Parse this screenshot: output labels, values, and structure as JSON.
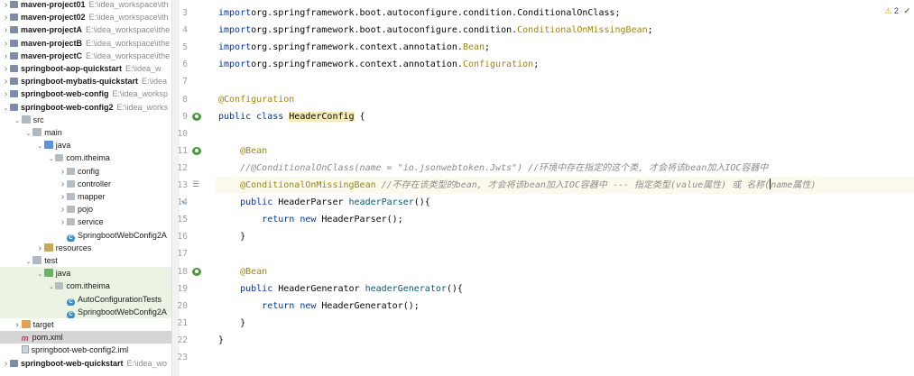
{
  "tree": [
    {
      "label": "maven-project01",
      "path": "E:\\idea_workspace\\ith",
      "icon": "module-icon",
      "arrow": "right",
      "depth": 0,
      "bold": true
    },
    {
      "label": "maven-project02",
      "path": "E:\\idea_workspace\\ith",
      "icon": "module-icon",
      "arrow": "right",
      "depth": 0,
      "bold": true
    },
    {
      "label": "maven-projectA",
      "path": "E:\\idea_workspace\\ithe",
      "icon": "module-icon",
      "arrow": "right",
      "depth": 0,
      "bold": true
    },
    {
      "label": "maven-projectB",
      "path": "E:\\idea_workspace\\ithe",
      "icon": "module-icon",
      "arrow": "right",
      "depth": 0,
      "bold": true
    },
    {
      "label": "maven-projectC",
      "path": "E:\\idea_workspace\\ithe",
      "icon": "module-icon",
      "arrow": "right",
      "depth": 0,
      "bold": true
    },
    {
      "label": "springboot-aop-quickstart",
      "path": "E:\\idea_w",
      "icon": "module-icon",
      "arrow": "right",
      "depth": 0,
      "bold": true
    },
    {
      "label": "springboot-mybatis-quickstart",
      "path": "E:\\idea",
      "icon": "module-icon",
      "arrow": "right",
      "depth": 0,
      "bold": true
    },
    {
      "label": "springboot-web-config",
      "path": "E:\\idea_worksp",
      "icon": "module-icon",
      "arrow": "right",
      "depth": 0,
      "bold": true
    },
    {
      "label": "springboot-web-config2",
      "path": "E:\\idea_works",
      "icon": "module-icon",
      "arrow": "down",
      "depth": 0,
      "bold": true
    },
    {
      "label": "src",
      "path": "",
      "icon": "folder-icon",
      "arrow": "down",
      "depth": 1,
      "bold": false
    },
    {
      "label": "main",
      "path": "",
      "icon": "folder-icon",
      "arrow": "down",
      "depth": 2,
      "bold": false
    },
    {
      "label": "java",
      "path": "",
      "icon": "source-folder-icon",
      "arrow": "down",
      "depth": 3,
      "bold": false
    },
    {
      "label": "com.itheima",
      "path": "",
      "icon": "package-icon",
      "arrow": "down",
      "depth": 4,
      "bold": false
    },
    {
      "label": "config",
      "path": "",
      "icon": "package-icon",
      "arrow": "right",
      "depth": 5,
      "bold": false
    },
    {
      "label": "controller",
      "path": "",
      "icon": "package-icon",
      "arrow": "right",
      "depth": 5,
      "bold": false
    },
    {
      "label": "mapper",
      "path": "",
      "icon": "package-icon",
      "arrow": "right",
      "depth": 5,
      "bold": false
    },
    {
      "label": "pojo",
      "path": "",
      "icon": "package-icon",
      "arrow": "right",
      "depth": 5,
      "bold": false
    },
    {
      "label": "service",
      "path": "",
      "icon": "package-icon",
      "arrow": "right",
      "depth": 5,
      "bold": false
    },
    {
      "label": "SpringbootWebConfig2A",
      "path": "",
      "icon": "spring-class-icon",
      "arrow": "none",
      "depth": 5,
      "bold": false
    },
    {
      "label": "resources",
      "path": "",
      "icon": "resources-folder-icon",
      "arrow": "right",
      "depth": 3,
      "bold": false
    },
    {
      "label": "test",
      "path": "",
      "icon": "folder-icon",
      "arrow": "down",
      "depth": 2,
      "bold": false
    },
    {
      "label": "java",
      "path": "",
      "icon": "test-source-folder-icon",
      "arrow": "down",
      "depth": 3,
      "bold": false,
      "highlight": "green"
    },
    {
      "label": "com.itheima",
      "path": "",
      "icon": "package-icon",
      "arrow": "down",
      "depth": 4,
      "bold": false,
      "highlight": "green"
    },
    {
      "label": "AutoConfigurationTests",
      "path": "",
      "icon": "test-class-icon",
      "arrow": "none",
      "depth": 5,
      "bold": false,
      "highlight": "green"
    },
    {
      "label": "SpringbootWebConfig2A",
      "path": "",
      "icon": "test-class-icon",
      "arrow": "none",
      "depth": 5,
      "bold": false,
      "highlight": "green"
    },
    {
      "label": "target",
      "path": "",
      "icon": "target-folder-icon",
      "arrow": "right",
      "depth": 1,
      "bold": false
    },
    {
      "label": "pom.xml",
      "path": "",
      "icon": "maven-icon",
      "arrow": "none",
      "depth": 1,
      "bold": false,
      "highlight": "selected"
    },
    {
      "label": "springboot-web-config2.iml",
      "path": "",
      "icon": "iml-file-icon",
      "arrow": "none",
      "depth": 1,
      "bold": false
    },
    {
      "label": "springboot-web-quickstart",
      "path": "E:\\idea_wo",
      "icon": "module-icon",
      "arrow": "right",
      "depth": 0,
      "bold": true
    }
  ],
  "inspections": {
    "warnings": "2"
  },
  "lines": [
    {
      "n": "3",
      "tokens": [
        [
          "kw",
          "import"
        ],
        [
          "",
          "org.springframework.boot.autoconfigure.condition.ConditionalOnClass;"
        ]
      ]
    },
    {
      "n": "4",
      "tokens": [
        [
          "kw",
          "import"
        ],
        [
          "",
          "org.springframework.boot.autoconfigure.condition."
        ],
        [
          "ann",
          "ConditionalOnMissingBean"
        ],
        [
          "",
          ";"
        ]
      ]
    },
    {
      "n": "5",
      "tokens": [
        [
          "kw",
          "import"
        ],
        [
          "",
          "org.springframework.context.annotation."
        ],
        [
          "ann",
          "Bean"
        ],
        [
          "",
          ";"
        ]
      ]
    },
    {
      "n": "6",
      "tokens": [
        [
          "kw",
          "import"
        ],
        [
          "",
          "org.springframework.context.annotation."
        ],
        [
          "ann",
          "Configuration"
        ],
        [
          "",
          ";"
        ]
      ]
    },
    {
      "n": "7",
      "tokens": []
    },
    {
      "n": "8",
      "tokens": [
        [
          "ann",
          "@Configuration"
        ]
      ]
    },
    {
      "n": "9",
      "tokens": [
        [
          "kw",
          "public class"
        ],
        [
          "",
          " "
        ],
        [
          "cls-hl",
          "HeaderConfig"
        ],
        [
          "",
          " {"
        ]
      ],
      "gutter": "bean-gutter-icon"
    },
    {
      "n": "10",
      "tokens": []
    },
    {
      "n": "11",
      "tokens": [
        [
          "",
          "    "
        ],
        [
          "ann",
          "@Bean"
        ]
      ],
      "gutter": "bean-gutter-icon"
    },
    {
      "n": "12",
      "tokens": [
        [
          "",
          "    "
        ],
        [
          "cmt",
          "//@ConditionalOnClass(name = \"io.jsonwebtoken.Jwts\") //环境中存在指定的这个类, 才会将该bean加入IOC容器中"
        ]
      ]
    },
    {
      "n": "13",
      "tokens": [
        [
          "",
          "    "
        ],
        [
          "ann",
          "@ConditionalOnMissingBean"
        ],
        [
          "",
          ""
        ],
        [
          "cmt",
          " //不存在该类型的bean, 才会将该bean加入IOC容器中 --- 指定类型(value属性) 或 名称("
        ],
        [
          "caret",
          ""
        ],
        [
          "cmt",
          "name属性)"
        ]
      ],
      "current": true,
      "gutter": "hint-gutter-icon"
    },
    {
      "n": "14",
      "tokens": [
        [
          "",
          "    "
        ],
        [
          "kw",
          "public"
        ],
        [
          "",
          " HeaderParser "
        ],
        [
          "fn",
          "headerParser"
        ],
        [
          "",
          "(){"
        ]
      ],
      "gutter": "override-gutter-icon"
    },
    {
      "n": "15",
      "tokens": [
        [
          "",
          "        "
        ],
        [
          "kw",
          "return new"
        ],
        [
          "",
          " HeaderParser();"
        ]
      ]
    },
    {
      "n": "16",
      "tokens": [
        [
          "",
          "    }"
        ]
      ]
    },
    {
      "n": "17",
      "tokens": []
    },
    {
      "n": "18",
      "tokens": [
        [
          "",
          "    "
        ],
        [
          "ann",
          "@Bean"
        ]
      ],
      "gutter": "bean-gutter-icon"
    },
    {
      "n": "19",
      "tokens": [
        [
          "",
          "    "
        ],
        [
          "kw",
          "public"
        ],
        [
          "",
          " HeaderGenerator "
        ],
        [
          "fn",
          "headerGenerator"
        ],
        [
          "",
          "(){"
        ]
      ]
    },
    {
      "n": "20",
      "tokens": [
        [
          "",
          "        "
        ],
        [
          "kw",
          "return new"
        ],
        [
          "",
          " HeaderGenerator();"
        ]
      ]
    },
    {
      "n": "21",
      "tokens": [
        [
          "",
          "    }"
        ]
      ]
    },
    {
      "n": "22",
      "tokens": [
        [
          "",
          "}"
        ]
      ]
    },
    {
      "n": "23",
      "tokens": []
    }
  ]
}
